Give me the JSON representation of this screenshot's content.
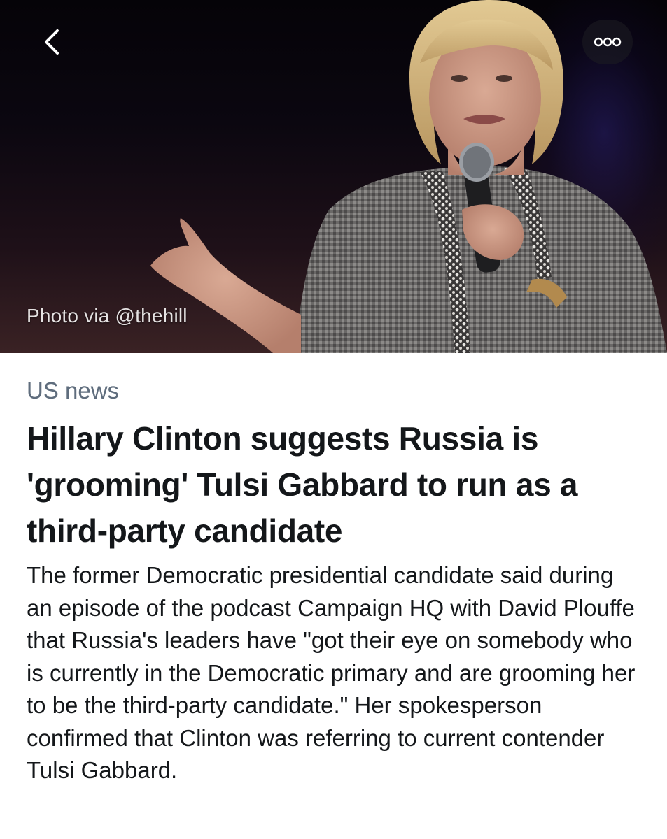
{
  "header": {
    "back_icon": "chevron-left-icon",
    "more_icon": "more-options-icon",
    "photo_credit": "Photo via @thehill"
  },
  "article": {
    "category": "US news",
    "headline": "Hillary Clinton suggests Russia is 'grooming' Tulsi Gabbard to run as a third-party candidate",
    "summary": "The former Democratic presidential candidate said during an episode of the podcast Campaign HQ with David Plouffe that Russia's leaders have \"got their eye on somebody who is currently in the Democratic primary and are grooming her to be the third-party candidate.\" Her spokesperson confirmed that Clinton was referring to current contender Tulsi Gabbard."
  },
  "colors": {
    "category_text": "#5f6d7d",
    "headline_text": "#14171a",
    "hero_background": "#0b0710"
  }
}
